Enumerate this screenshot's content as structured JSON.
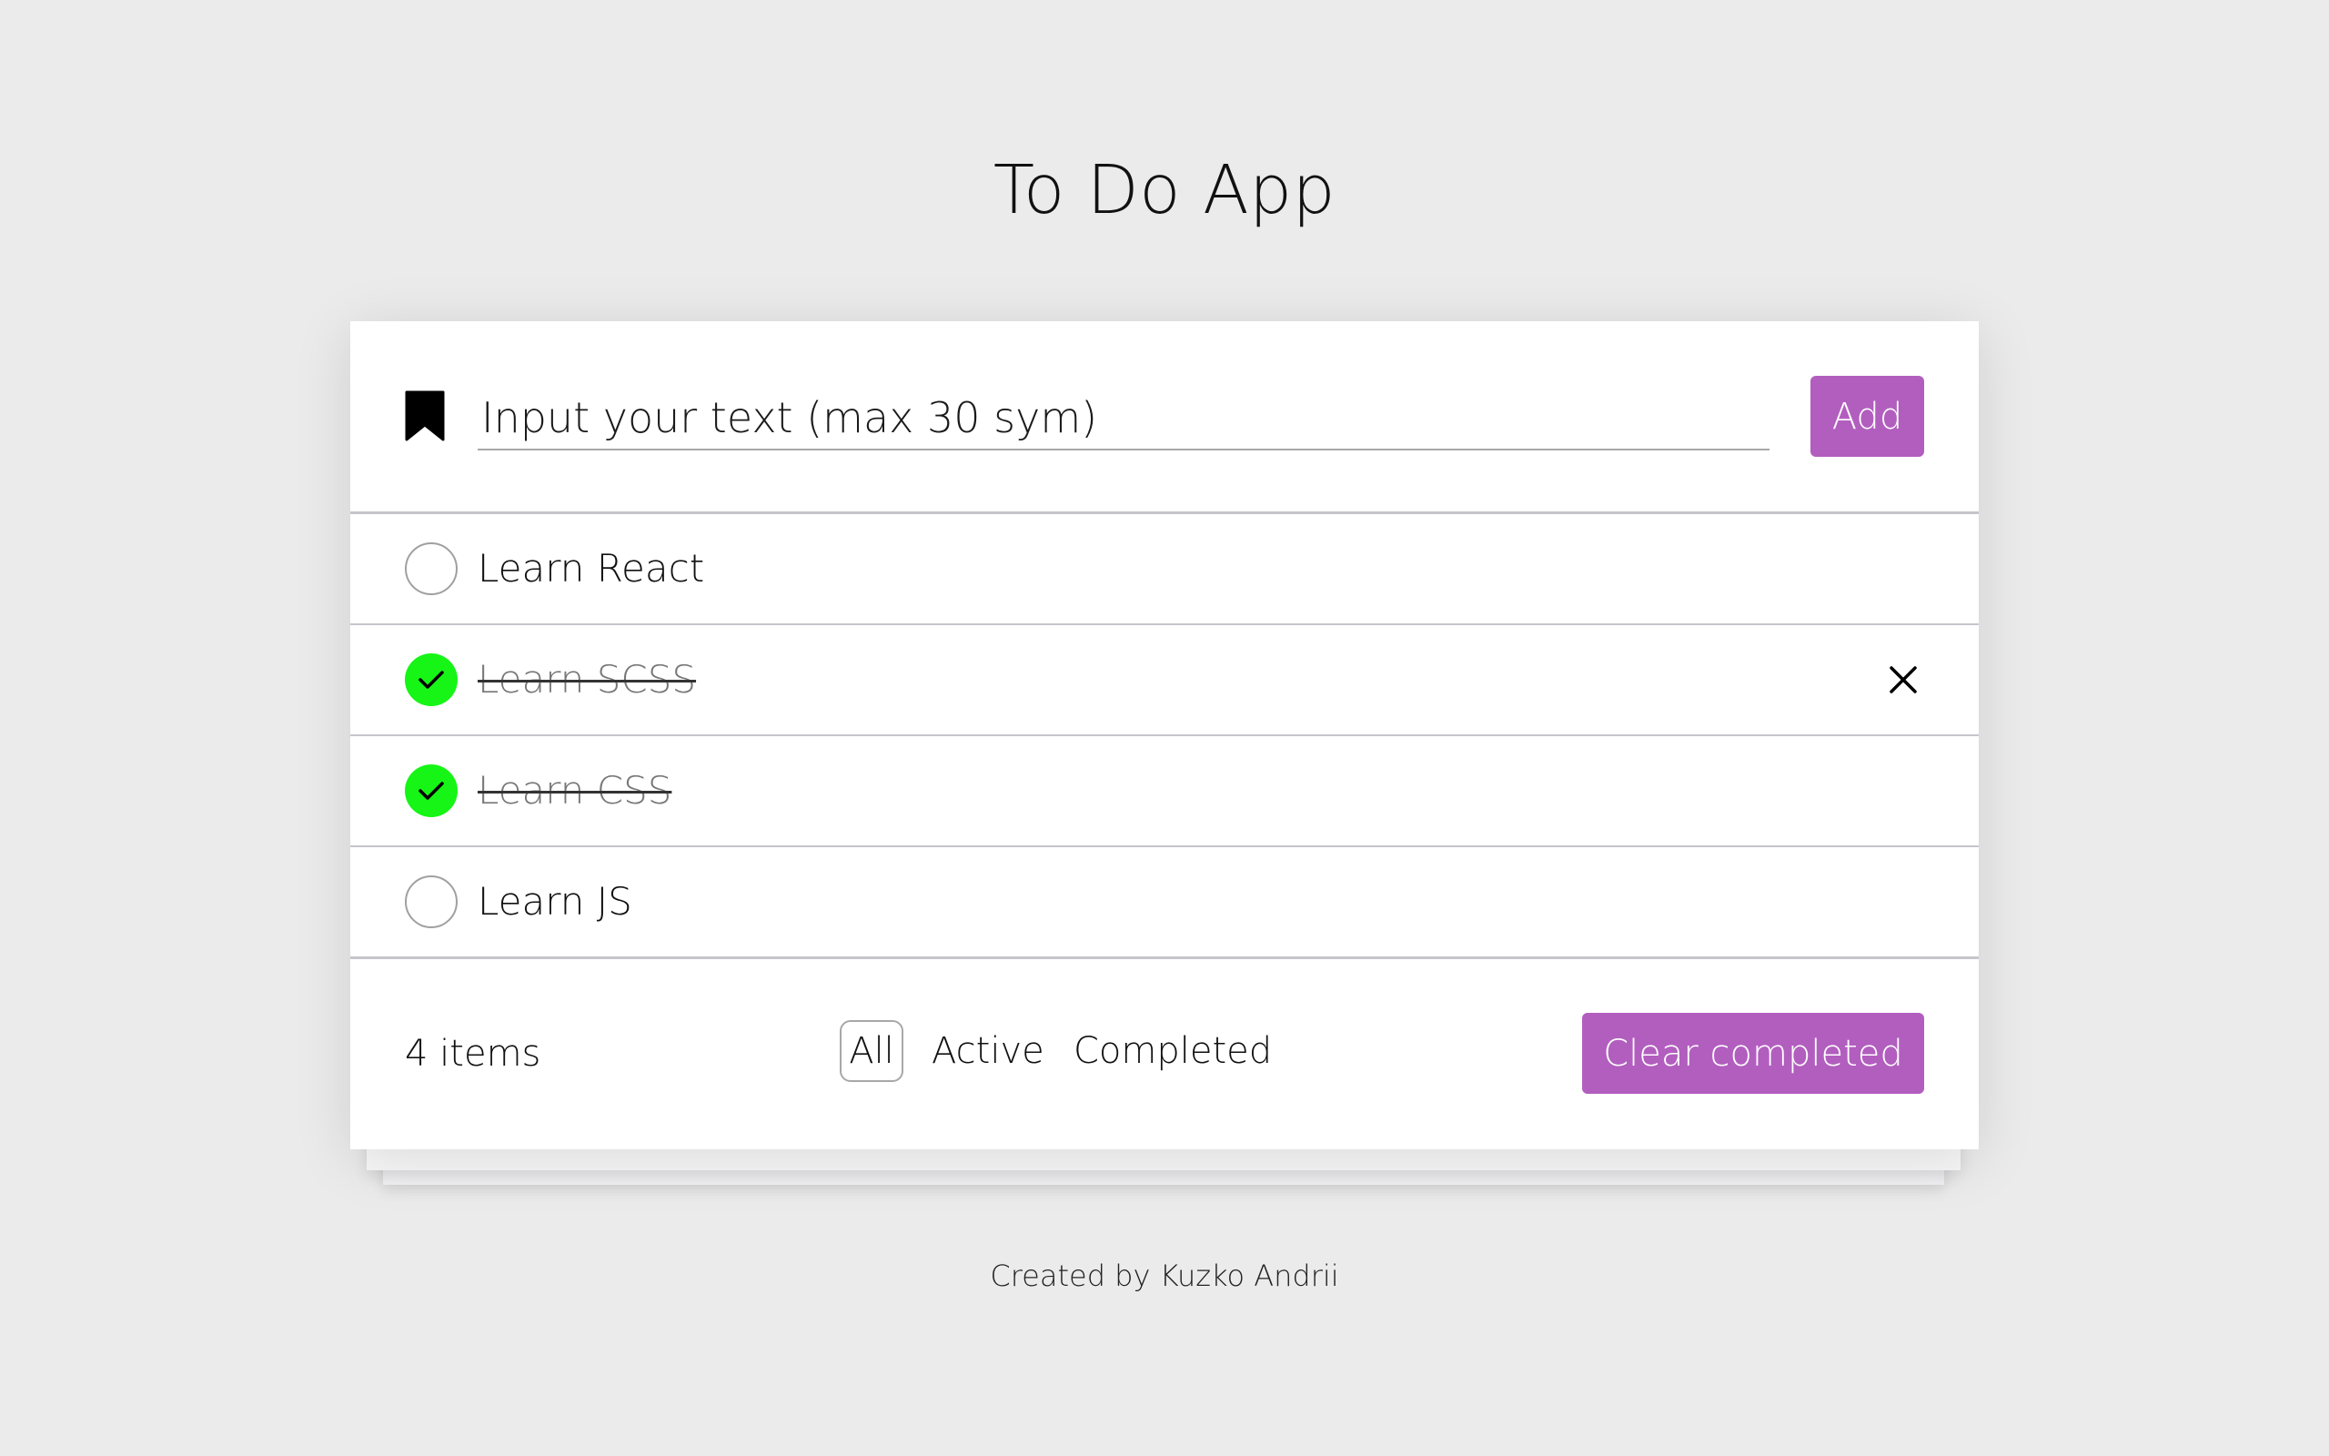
{
  "app": {
    "title": "To Do App"
  },
  "input_row": {
    "placeholder": "Input your text (max 30 sym)",
    "value": "",
    "add_label": "Add",
    "icon": "bookmark-icon"
  },
  "todos": [
    {
      "label": "Learn React",
      "completed": false
    },
    {
      "label": "Learn SCSS",
      "completed": true,
      "delete_icon_visible": true
    },
    {
      "label": "Learn CSS",
      "completed": true
    },
    {
      "label": "Learn JS",
      "completed": false
    }
  ],
  "footer": {
    "items_count": "4 items",
    "filters": [
      {
        "label": "All",
        "selected": true
      },
      {
        "label": "Active",
        "selected": false
      },
      {
        "label": "Completed",
        "selected": false
      }
    ],
    "clear_label": "Clear completed"
  },
  "credit": "Created by Kuzko Andrii",
  "colors": {
    "background": "#ebebeb",
    "accent": "#b25ebf",
    "check_done": "#16f516",
    "divider": "#c5c5cc"
  }
}
